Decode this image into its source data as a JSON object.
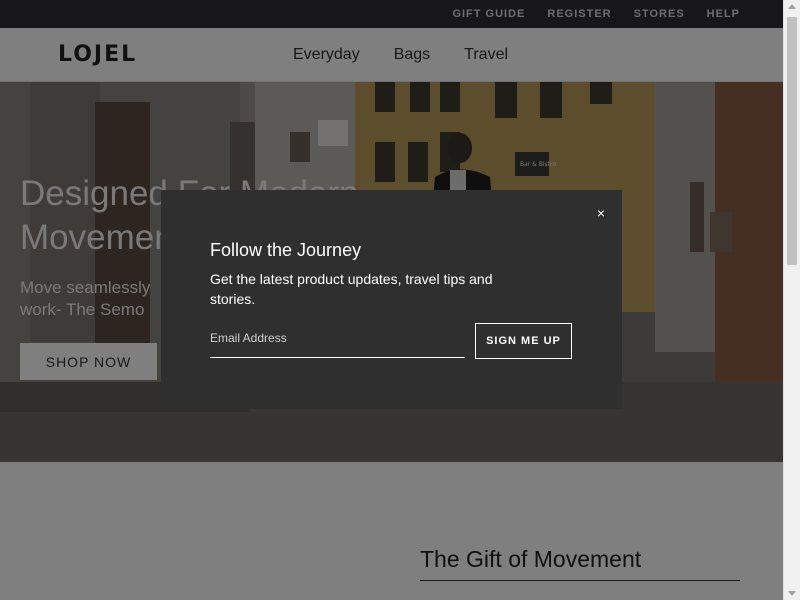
{
  "utility_nav": {
    "items": [
      {
        "label": "GIFT GUIDE"
      },
      {
        "label": "REGISTER"
      },
      {
        "label": "STORES"
      },
      {
        "label": "HELP"
      }
    ]
  },
  "header": {
    "logo": "LOJEL",
    "nav": [
      {
        "label": "Everyday"
      },
      {
        "label": "Bags"
      },
      {
        "label": "Travel"
      }
    ]
  },
  "hero": {
    "title_line1": "Designed For Modern",
    "title_line2": "Movement",
    "subtitle_line1": "Move seamlessly",
    "subtitle_line2": "work- The Semo",
    "cta": "SHOP NOW",
    "sign_text": "Bar & Bistro"
  },
  "section": {
    "title": "The Gift of Movement"
  },
  "modal": {
    "close": "×",
    "title": "Follow the Journey",
    "text": "Get the latest product updates, travel tips and stories.",
    "email_placeholder": "Email Address",
    "email_value": "",
    "submit": "SIGN ME UP"
  },
  "colors": {
    "utility_bar": "#2f2d32",
    "modal_bg": "#2f2f2f",
    "overlay": "rgba(0,0,0,0.5)"
  }
}
